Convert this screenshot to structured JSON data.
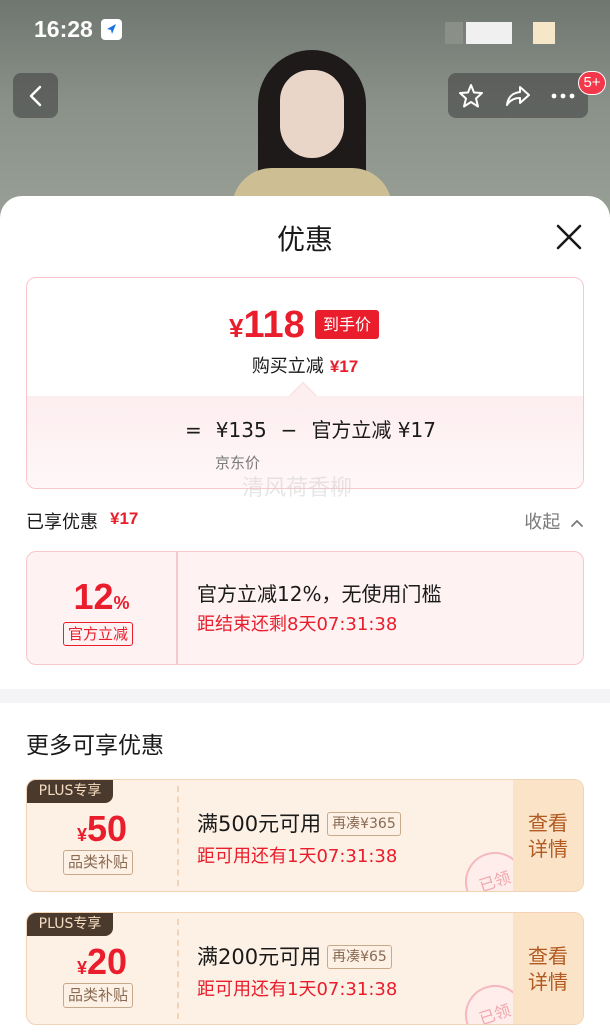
{
  "status_bar": {
    "time": "16:28"
  },
  "top_nav": {
    "badge": "5+"
  },
  "sheet": {
    "title": "优惠",
    "price": {
      "currency": "¥",
      "final": "118",
      "final_tag": "到手价",
      "buy_reduce_label": "购买立减",
      "buy_reduce_amount": "¥17",
      "eq": "=",
      "jd_price": "¥135",
      "minus": "−",
      "official_reduce": "官方立减 ¥17",
      "jd_price_label": "京东价"
    },
    "watermark": "清风荷香柳",
    "enjoyed": {
      "label": "已享优惠",
      "amount": "¥17",
      "collapse_label": "收起"
    },
    "discount": {
      "percent": "12",
      "percent_unit": "%",
      "tag": "官方立减",
      "title": "官方立减12%，无使用门槛",
      "countdown": "距结束还剩8天07:31:38"
    },
    "more_title": "更多可享优惠",
    "coupons": [
      {
        "plus_tag": "PLUS专享",
        "currency": "¥",
        "amount": "50",
        "category_tag": "品类补贴",
        "condition": "满500元可用",
        "topup": "再凑¥365",
        "countdown": "距可用还有1天07:31:38",
        "detail_line1": "查看",
        "detail_line2": "详情",
        "stamp": "已领"
      },
      {
        "plus_tag": "PLUS专享",
        "currency": "¥",
        "amount": "20",
        "category_tag": "品类补贴",
        "condition": "满200元可用",
        "topup": "再凑¥65",
        "countdown": "距可用还有1天07:31:38",
        "detail_line1": "查看",
        "detail_line2": "详情",
        "stamp": "已领"
      }
    ]
  },
  "colors": {
    "accent_red": "#e91d2c",
    "coupon_bg": "#fdf1e6",
    "plus_tag_bg": "#4a3a2e"
  }
}
